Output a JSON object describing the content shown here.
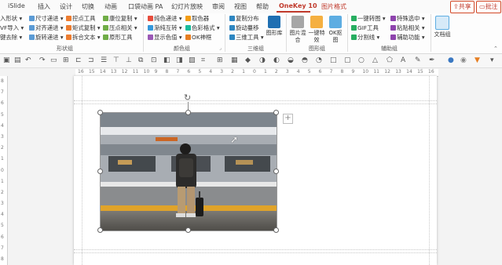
{
  "tabs": [
    {
      "label": "iSlide",
      "active": false
    },
    {
      "label": "插入",
      "active": false
    },
    {
      "label": "设计",
      "active": false
    },
    {
      "label": "切换",
      "active": false
    },
    {
      "label": "动画",
      "active": false
    },
    {
      "label": "口袋动画 PA",
      "active": false
    },
    {
      "label": "幻灯片放映",
      "active": false
    },
    {
      "label": "审阅",
      "active": false
    },
    {
      "label": "视图",
      "active": false
    },
    {
      "label": "帮助",
      "active": false
    },
    {
      "label": "OneKey 10",
      "active": true
    },
    {
      "label": "图片格式",
      "active": false
    }
  ],
  "header": {
    "share_label": "共享",
    "comment_label": "批注"
  },
  "ribbon": {
    "shape_group": {
      "label": "形状组",
      "items": [
        "入形状",
        "VF导入",
        "键去除",
        "尺寸递进",
        "对齐递进",
        "旋转递进",
        "控点工具",
        "矩式复制",
        "拆合文本",
        "康位复制",
        "压点相关",
        "原形工具"
      ]
    },
    "color_group": {
      "label": "颜色组",
      "items": [
        "纯色递进",
        "渐纯互转",
        "显示色值",
        "取色器",
        "色彩格式",
        "OK神框"
      ]
    },
    "three_d_group": {
      "label": "三维组",
      "items": [
        "复制分布",
        "旋动蔓移",
        "三维工具"
      ],
      "big_label": "图形库"
    },
    "image_group": {
      "label": "图形组",
      "items": [
        "图片混合",
        "一键特效",
        "OK抠图"
      ]
    },
    "aux_group": {
      "label": "辅助组",
      "items": [
        "一键转图",
        "GIF工具",
        "分割线",
        "特殊选中",
        "粘贴相关",
        "辅助功能"
      ]
    },
    "doc_group": {
      "label": "文档组"
    }
  },
  "ruler": {
    "h_ticks": [
      "16",
      "15",
      "14",
      "13",
      "12",
      "11",
      "10",
      "9",
      "8",
      "7",
      "6",
      "5",
      "4",
      "3",
      "2",
      "1",
      "0",
      "1",
      "2",
      "3",
      "4",
      "5",
      "6",
      "7",
      "8",
      "9",
      "10",
      "11",
      "12",
      "13",
      "14",
      "15",
      "16"
    ],
    "v_ticks": [
      "8",
      "7",
      "6",
      "5",
      "4",
      "3",
      "2",
      "1",
      "0",
      "1",
      "2",
      "3",
      "4",
      "5",
      "6",
      "7",
      "8"
    ]
  },
  "accent": "#c0392b"
}
